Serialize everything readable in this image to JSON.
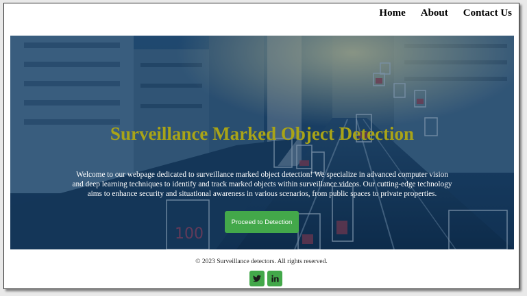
{
  "nav": {
    "items": [
      {
        "label": "Home"
      },
      {
        "label": "About"
      },
      {
        "label": "Contact Us"
      }
    ]
  },
  "hero": {
    "title": "Surveillance Marked Object Detection",
    "description": "Welcome to our webpage dedicated to surveillance marked object detection! We specialize in advanced computer vision and deep learning techniques to identify and track marked objects within surveillance videos. Our cutting-edge technology aims to enhance security and situational awareness in various scenarios, from public spaces to private properties.",
    "cta_label": "Proceed to Detection",
    "overlay_label": "100"
  },
  "footer": {
    "copyright": "© 2023 Surveillance detectors. All rights reserved.",
    "socials": [
      {
        "icon": "twitter-icon"
      },
      {
        "icon": "linkedin-icon"
      }
    ]
  },
  "colors": {
    "accent": "#43a84a",
    "title": "#a9a417",
    "hero_tint": "#0c325a"
  }
}
